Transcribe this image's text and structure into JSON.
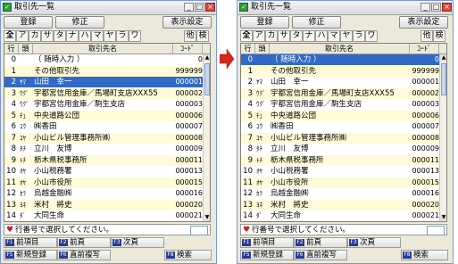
{
  "window": {
    "title": "取引先一覧",
    "buttons": {
      "register": "登録",
      "edit": "修正",
      "display_settings": "表示設定"
    }
  },
  "tabs": [
    "全",
    "ア",
    "カ",
    "サ",
    "タ",
    "ナ",
    "ハ",
    "マ",
    "ヤ",
    "ラ",
    "ワ",
    "他",
    "検"
  ],
  "grid": {
    "headers": {
      "row_no": "行",
      "kana": "頭",
      "name": "取引先名",
      "code": "ｺｰﾄﾞ"
    },
    "rows": [
      {
        "no": "0",
        "kana": "",
        "name": "（ 随時入力 ）",
        "code": "0"
      },
      {
        "no": "1",
        "kana": "",
        "name": "その他取引先",
        "code": "999999"
      },
      {
        "no": "2",
        "kana": "ﾔﾏ",
        "name": "山田　幸一",
        "code": "000001"
      },
      {
        "no": "3",
        "kana": "ｳｸﾞ",
        "name": "宇都宮信用金庫／馬場町支店XXX55",
        "code": "000002"
      },
      {
        "no": "4",
        "kana": "ｳｸﾞ",
        "name": "宇都宮信用金庫／駒生支店",
        "code": "000003"
      },
      {
        "no": "5",
        "kana": "ﾁｭ",
        "name": "中央道路公団",
        "code": "000006"
      },
      {
        "no": "6",
        "kana": "ｺｳ",
        "name": "㈱香田",
        "code": "000007"
      },
      {
        "no": "7",
        "kana": "ｺﾔ",
        "name": "小山ビル管理事務所㈱",
        "code": "000008"
      },
      {
        "no": "8",
        "kana": "ﾀﾁ",
        "name": "立川　友博",
        "code": "000009"
      },
      {
        "no": "9",
        "kana": "ﾄﾁ",
        "name": "栃木県税事務所",
        "code": "000011"
      },
      {
        "no": "10",
        "kana": "ｵﾔ",
        "name": "小山税務署",
        "code": "000013"
      },
      {
        "no": "11",
        "kana": "ｵﾔ",
        "name": "小山市役所",
        "code": "000015"
      },
      {
        "no": "12",
        "kana": "ｶﾗ",
        "name": "烏越金融㈱",
        "code": "000016"
      },
      {
        "no": "13",
        "kana": "ﾖﾈ",
        "name": "米村　將史",
        "code": "000020"
      },
      {
        "no": "14",
        "kana": "ﾀﾞ",
        "name": "大同生命",
        "code": "000021"
      }
    ]
  },
  "status": {
    "message": "行番号で選択してください。"
  },
  "function_keys": [
    {
      "key": "F1",
      "label": "前項目"
    },
    {
      "key": "F2",
      "label": "前頁"
    },
    {
      "key": "F3",
      "label": "次頁"
    },
    {
      "key": "F5",
      "label": "新規登録"
    },
    {
      "key": "F6",
      "label": "直前複写"
    },
    {
      "key": "F8",
      "label": "検索"
    }
  ],
  "colors": {
    "selection": "#316ac5",
    "alt_row": "#fffbd7",
    "arrow": "#d9261c"
  }
}
